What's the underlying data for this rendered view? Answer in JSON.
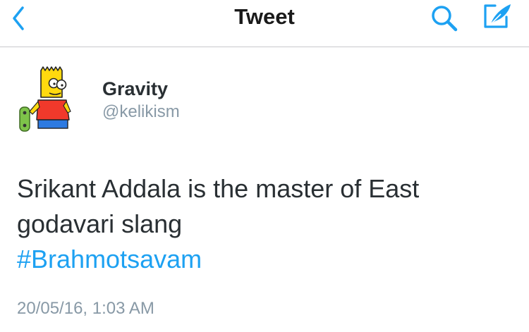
{
  "nav": {
    "title": "Tweet",
    "back_icon": "chevron-left-icon",
    "search_icon": "search-icon",
    "compose_icon": "compose-icon",
    "accent_color": "#1da1f2"
  },
  "author": {
    "display_name": "Gravity",
    "username": "@kelikism",
    "avatar_icon": "cartoon-avatar"
  },
  "tweet": {
    "text_line1": "Srikant Addala is the master of East",
    "text_line2": "godavari slang",
    "hashtag": "#Brahmotsavam",
    "timestamp": "20/05/16, 1:03 AM"
  }
}
